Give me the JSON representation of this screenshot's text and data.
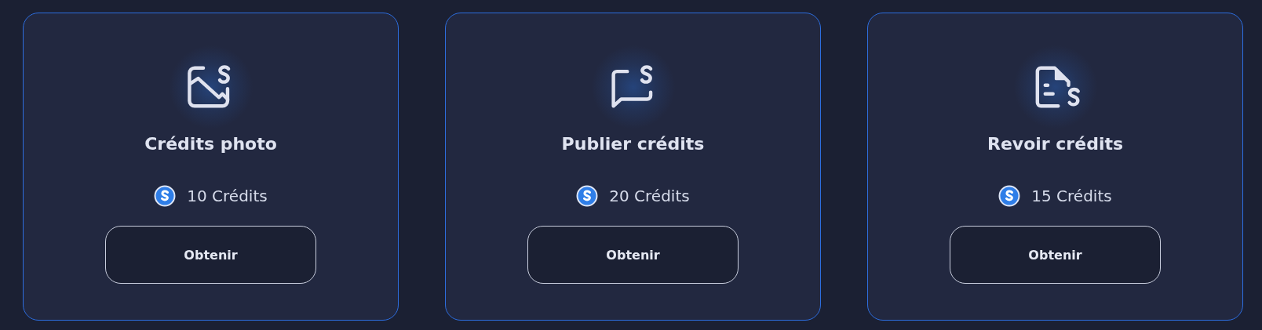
{
  "cards": [
    {
      "kind": "photo",
      "title": "Crédits photo",
      "price": "10 Crédits",
      "button": "Obtenir"
    },
    {
      "kind": "message",
      "title": "Publier crédits",
      "price": "20 Crédits",
      "button": "Obtenir"
    },
    {
      "kind": "document",
      "title": "Revoir crédits",
      "price": "15 Crédits",
      "button": "Obtenir"
    }
  ]
}
